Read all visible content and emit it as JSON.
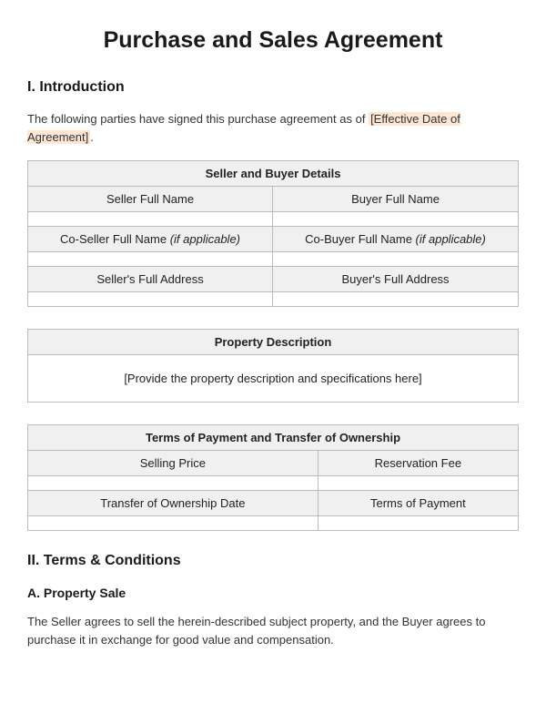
{
  "title": "Purchase and Sales Agreement",
  "sections": {
    "intro": {
      "heading": "I. Introduction",
      "paragraph_pre": "The following parties have signed this purchase agreement as of ",
      "paragraph_highlight": "[Effective Date of Agreement]",
      "paragraph_post": "."
    },
    "table1": {
      "title": "Seller and Buyer Details",
      "rows": [
        {
          "left": "Seller Full Name",
          "right": "Buyer Full Name"
        },
        {
          "left_pre": "Co-Seller Full Name ",
          "left_italic": "(if applicable)",
          "right_pre": "Co-Buyer Full Name ",
          "right_italic": "(if applicable)"
        },
        {
          "left": "Seller's Full Address",
          "right": "Buyer's Full Address"
        }
      ]
    },
    "table2": {
      "title": "Property Description",
      "placeholder": "[Provide the property description and specifications here]"
    },
    "table3": {
      "title": "Terms of Payment and Transfer of Ownership",
      "rows": [
        {
          "left": "Selling Price",
          "right": "Reservation Fee"
        },
        {
          "left": "Transfer of Ownership Date",
          "right": "Terms of Payment"
        }
      ]
    },
    "terms": {
      "heading": "II. Terms & Conditions",
      "subheading": "A. Property Sale",
      "paragraph": "The Seller agrees to sell the herein-described subject property, and the Buyer agrees to purchase it in exchange for good value and compensation."
    }
  }
}
